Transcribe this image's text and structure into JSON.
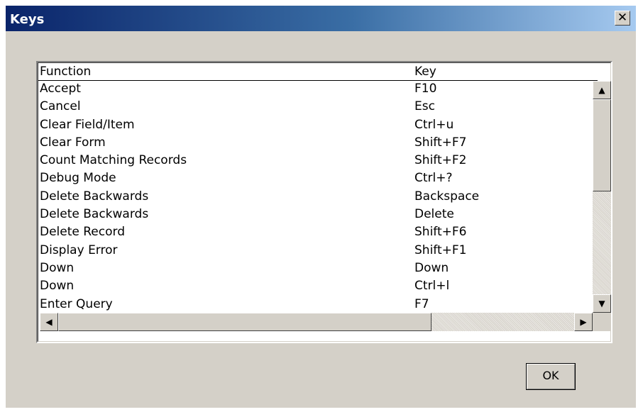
{
  "window": {
    "title": "Keys",
    "close_glyph": "✕"
  },
  "table": {
    "columns": [
      "Function",
      "Key"
    ],
    "rows": [
      {
        "function": "Accept",
        "key": "F10"
      },
      {
        "function": "Cancel",
        "key": "Esc"
      },
      {
        "function": "Clear Field/Item",
        "key": "Ctrl+u"
      },
      {
        "function": "Clear Form",
        "key": "Shift+F7"
      },
      {
        "function": "Count Matching Records",
        "key": "Shift+F2"
      },
      {
        "function": "Debug Mode",
        "key": "Ctrl+?"
      },
      {
        "function": "Delete Backwards",
        "key": "Backspace"
      },
      {
        "function": "Delete Backwards",
        "key": "Delete"
      },
      {
        "function": "Delete Record",
        "key": "Shift+F6"
      },
      {
        "function": "Display Error",
        "key": "Shift+F1"
      },
      {
        "function": "Down",
        "key": "Down"
      },
      {
        "function": "Down",
        "key": "Ctrl+l"
      },
      {
        "function": "Enter Query",
        "key": "F7"
      }
    ]
  },
  "scrollbar": {
    "up": "▲",
    "down": "▼",
    "left": "◀",
    "right": "▶"
  },
  "buttons": {
    "ok_label": "OK"
  }
}
